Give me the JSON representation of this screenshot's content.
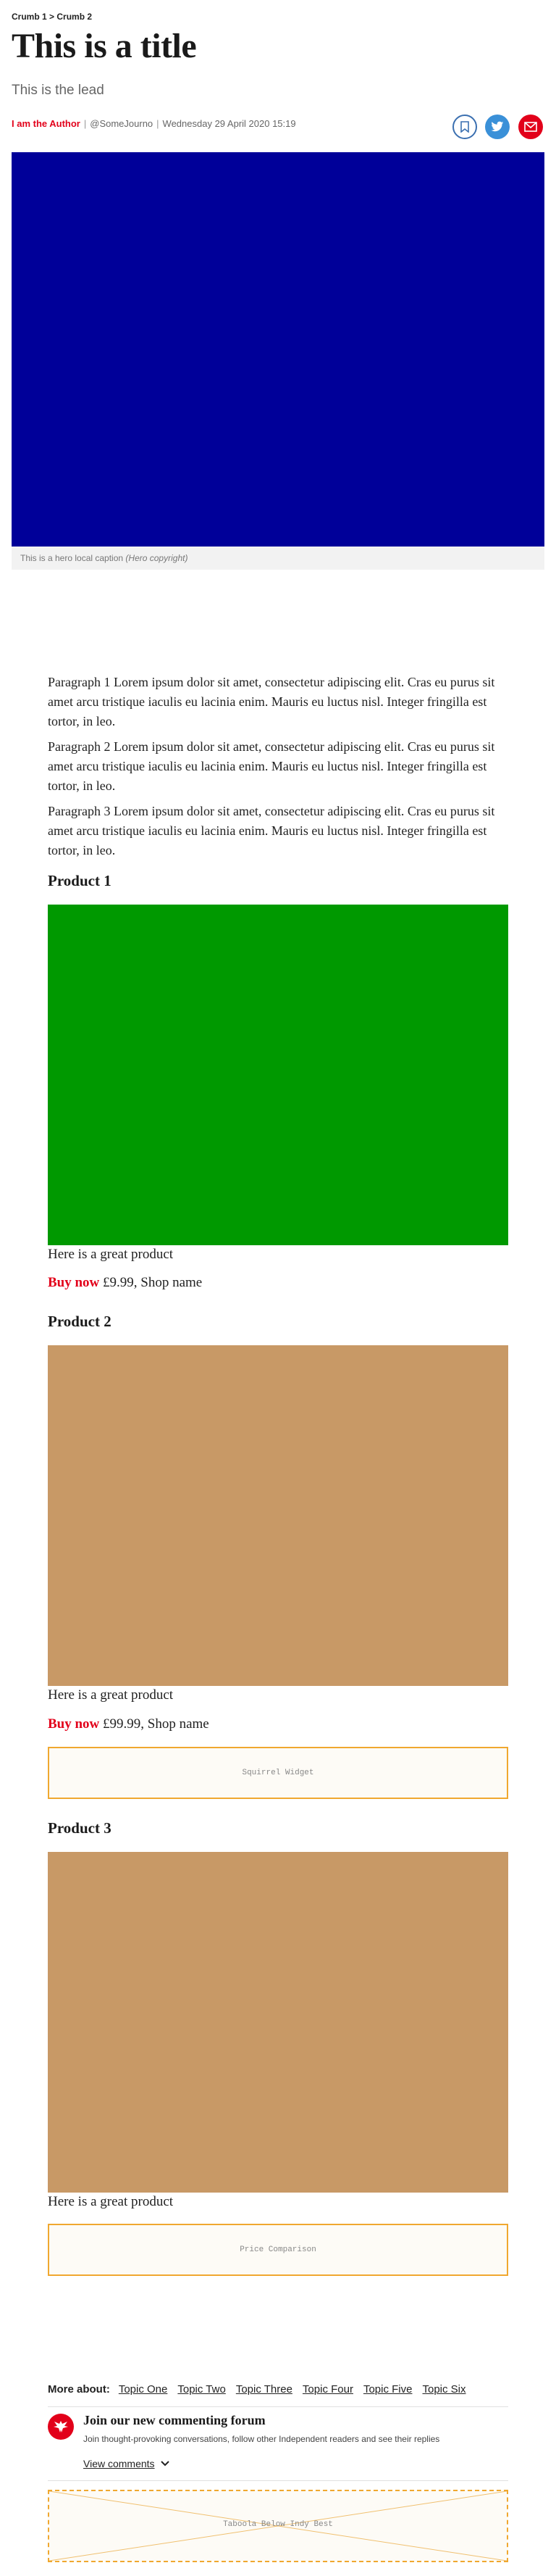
{
  "breadcrumb": {
    "crumb1": "Crumb 1",
    "separator": ">",
    "crumb2": "Crumb 2"
  },
  "article": {
    "title": "This is a title",
    "lead": "This is the lead",
    "author": "I am the Author",
    "handle": "@SomeJourno",
    "date": "Wednesday 29 April 2020 15:19",
    "hero_caption": "This is a hero local caption",
    "hero_copyright": "(Hero copyright)",
    "hero_color": "#000099"
  },
  "paragraphs": [
    "Paragraph 1 Lorem ipsum dolor sit amet, consectetur adipiscing elit. Cras eu purus sit amet arcu tristique iaculis eu lacinia enim. Mauris eu luctus nisl. Integer fringilla est tortor, in leo.",
    "Paragraph 2 Lorem ipsum dolor sit amet, consectetur adipiscing elit. Cras eu purus sit amet arcu tristique iaculis eu lacinia enim. Mauris eu luctus nisl. Integer fringilla est tortor, in leo.",
    "Paragraph 3 Lorem ipsum dolor sit amet, consectetur adipiscing elit. Cras eu purus sit amet arcu tristique iaculis eu lacinia enim. Mauris eu luctus nisl. Integer fringilla est tortor, in leo."
  ],
  "products": [
    {
      "heading": "Product 1",
      "image_color": "#009900",
      "description": "Here is a great product",
      "buy_label": "Buy now",
      "price": "£9.99, Shop name"
    },
    {
      "heading": "Product 2",
      "image_color": "#c89966",
      "description": "Here is a great product",
      "buy_label": "Buy now",
      "price": "£99.99, Shop name"
    },
    {
      "heading": "Product 3",
      "image_color": "#c89966",
      "description": "Here is a great product"
    }
  ],
  "widgets": {
    "squirrel": "Squirrel Widget",
    "price_comparison": "Price Comparison",
    "taboola": "Taboola Below Indy Best"
  },
  "more_about": {
    "label": "More about:",
    "topics": [
      "Topic One",
      "Topic Two",
      "Topic Three",
      "Topic Four",
      "Topic Five",
      "Topic Six"
    ]
  },
  "comments": {
    "title": "Join our new commenting forum",
    "subtitle": "Join thought-provoking conversations, follow other Independent readers and see their replies",
    "view_label": "View comments"
  },
  "icons": {
    "bookmark": "bookmark-icon",
    "twitter": "twitter-icon",
    "email": "email-icon",
    "comment": "independent-eagle-icon",
    "chevron": "chevron-down-icon"
  },
  "colors": {
    "accent": "#e2001a",
    "twitter": "#3a90d8",
    "widget_border": "#f0a830"
  }
}
